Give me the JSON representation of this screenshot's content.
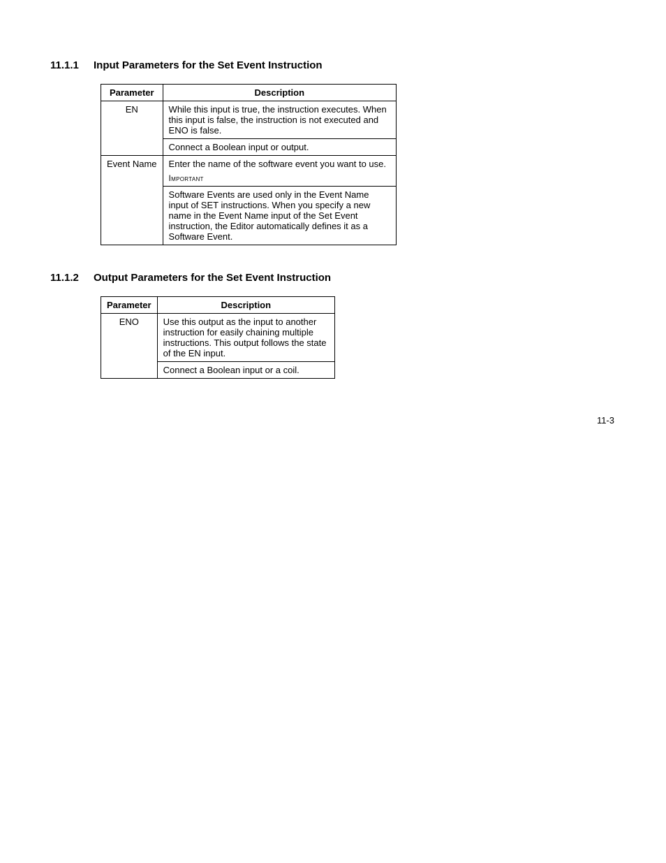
{
  "pageNumber": "11-3",
  "section1": {
    "number": "11.1.1",
    "title": "Input Parameters for the Set Event Instruction",
    "table": {
      "headers": {
        "parameter": "Parameter",
        "description": "Description"
      },
      "rows": [
        {
          "param": "EN",
          "desc1": "While this input is true, the instruction executes. When this input is false, the instruction is not executed and ENO is false.",
          "desc2": "Connect a Boolean input or output."
        },
        {
          "param": "Event Name",
          "desc1": "Enter the name of the software event you want to use.",
          "important": "Important",
          "desc2": "Software Events are used only in the Event Name input of SET instructions. When you specify a new name in the Event Name input of the Set Event instruction, the Editor automatically defines it as a Software Event."
        }
      ]
    }
  },
  "section2": {
    "number": "11.1.2",
    "title": "Output Parameters for the Set Event Instruction",
    "table": {
      "headers": {
        "parameter": "Parameter",
        "description": "Description"
      },
      "rows": [
        {
          "param": "ENO",
          "desc1": "Use this output as the input to another instruction for easily chaining multiple instructions. This output follows the state of the EN input.",
          "desc2": "Connect a Boolean input or a coil."
        }
      ]
    }
  }
}
